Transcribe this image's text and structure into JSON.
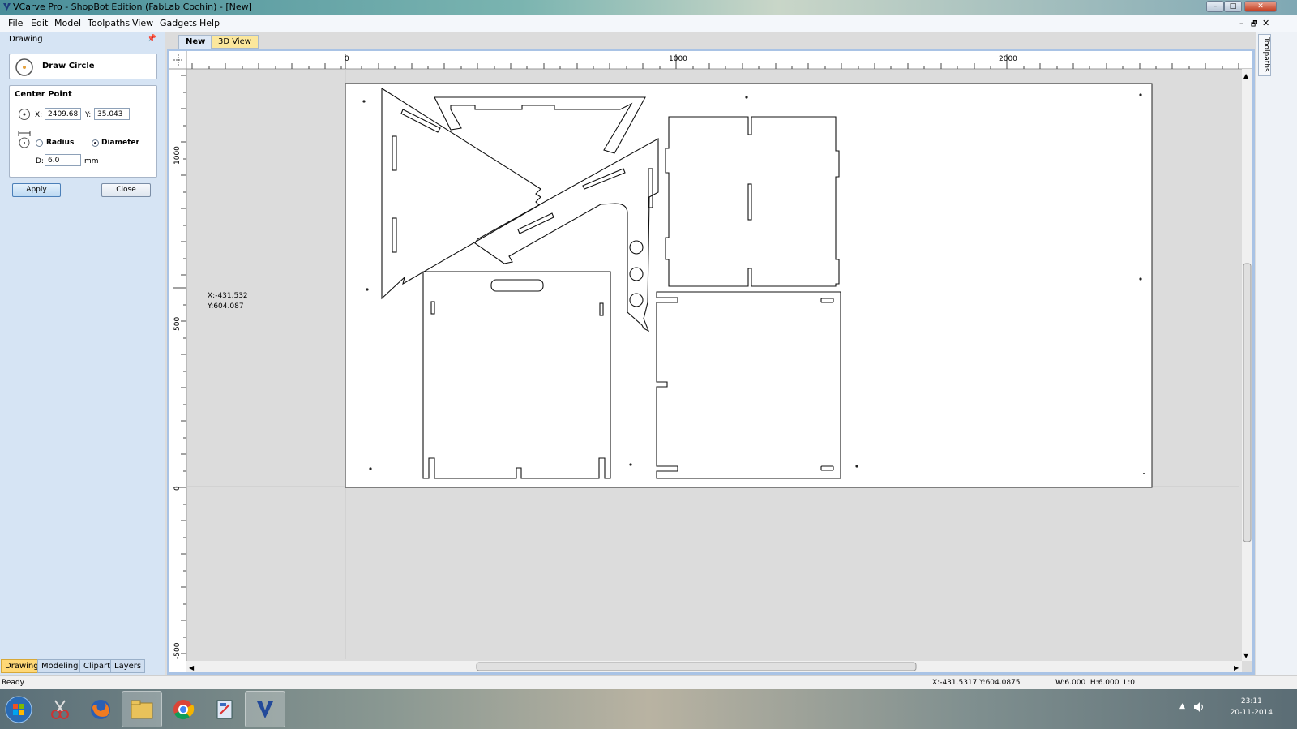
{
  "window": {
    "title": "VCarve Pro - ShopBot Edition (FabLab Cochin) - [New]",
    "minimize": "–",
    "maximize": "□",
    "close": "✕"
  },
  "menu": [
    "File",
    "Edit",
    "Model",
    "Toolpaths",
    "View",
    "Gadgets",
    "Help"
  ],
  "mdi_controls": {
    "minimize": "–",
    "restore": "🗗",
    "close": "✕"
  },
  "panel": {
    "title": "Drawing",
    "pin": "📌",
    "tool_title": "Draw Circle",
    "center_point": {
      "header": "Center Point",
      "x_label": "X:",
      "x_value": "2409.685",
      "y_label": "Y:",
      "y_value": "35.043"
    },
    "mode": {
      "radius_label": "Radius",
      "diameter_label": "Diameter",
      "selected": "Diameter",
      "d_label": "D:",
      "d_value": "6.0",
      "unit": "mm"
    },
    "apply_label": "Apply",
    "close_label": "Close",
    "tabs": [
      "Drawing",
      "Modeling",
      "Clipart",
      "Layers"
    ],
    "active_tab": "Drawing"
  },
  "doc_tabs": {
    "new": "New",
    "view3d": "3D View"
  },
  "right_tab": "Toolpaths",
  "rulers": {
    "top_labels": [
      "0",
      "1000",
      "2000"
    ],
    "left_labels": [
      "1000",
      "500",
      "0",
      "-500"
    ]
  },
  "cursor_readout": {
    "x": "X:-431.532",
    "y": "Y:604.087"
  },
  "status": {
    "left": "Ready",
    "coords": "X:-431.5317 Y:604.0875",
    "size": "W:6.000  H:6.000  L:0"
  },
  "taskbar": {
    "time": "23:11",
    "date": "20-11-2014",
    "tray_arrow": "▲"
  },
  "colors": {
    "panel_bg": "#d6e4f4",
    "active_tab": "#ffd877",
    "view_frame": "#a9c3e5",
    "canvas_bg": "#dcdcdc"
  }
}
